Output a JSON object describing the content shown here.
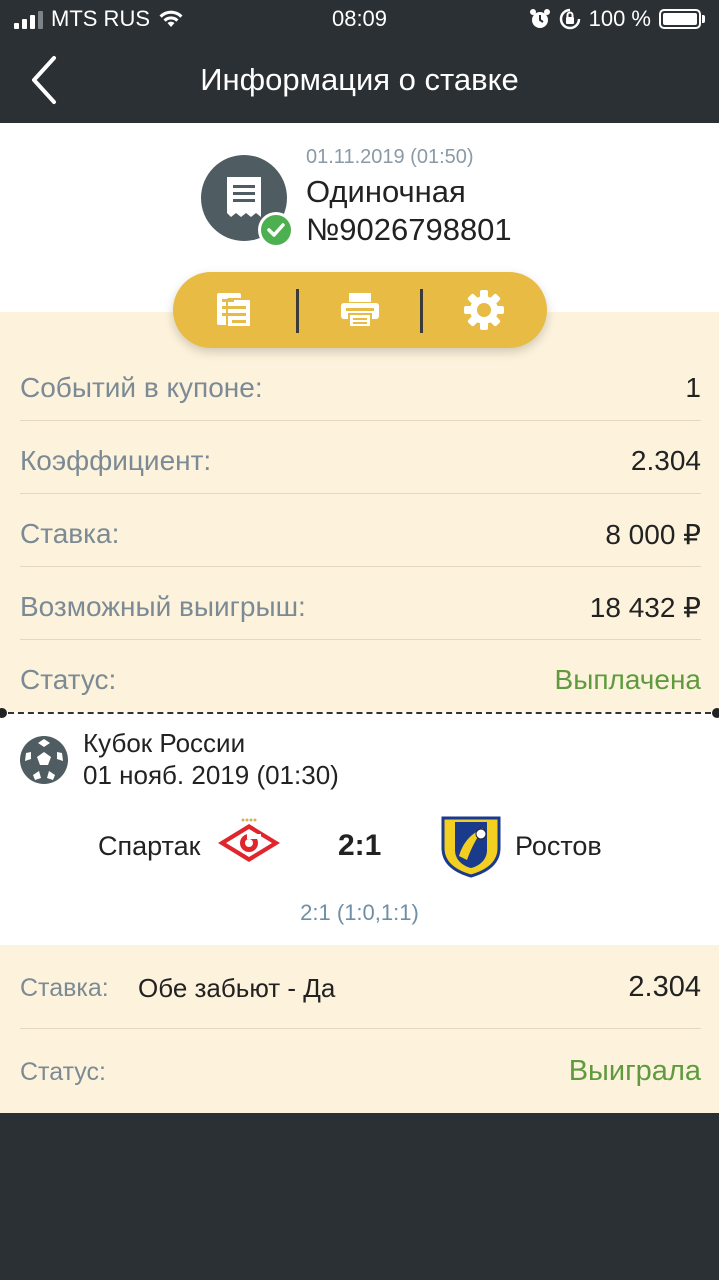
{
  "status_bar": {
    "carrier": "MTS RUS",
    "time": "08:09",
    "battery": "100 %",
    "battery_level": 1.0
  },
  "header": {
    "title": "Информация о ставке",
    "back_icon": "chevron-left-icon"
  },
  "bet": {
    "date": "01.11.2019 (01:50)",
    "type": "Одиночная",
    "number": "№9026798801",
    "icon": "receipt-icon",
    "badge_icon": "check-icon"
  },
  "actions": [
    {
      "icon": "document-list-icon"
    },
    {
      "icon": "printer-icon"
    },
    {
      "icon": "gear-icon"
    }
  ],
  "summary": [
    {
      "label": "Событий в купоне:",
      "value": "1"
    },
    {
      "label": "Коэффициент:",
      "value": "2.304"
    },
    {
      "label": "Ставка:",
      "value": "8 000 ₽"
    },
    {
      "label": "Возможный выигрыш:",
      "value": "18 432 ₽"
    },
    {
      "label": "Статус:",
      "value": "Выплачена"
    }
  ],
  "event": {
    "tournament": "Кубок России",
    "date": "01 нояб. 2019 (01:30)",
    "home_team": "Спартак",
    "away_team": "Ростов",
    "score": "2:1",
    "score_detail": "2:1 (1:0,1:1)",
    "sport_icon": "soccer-ball-icon"
  },
  "details": {
    "bet_label": "Ставка:",
    "bet_value": "Обе забьют - Да",
    "odds": "2.304",
    "status_label": "Статус:",
    "status_value": "Выиграла"
  },
  "colors": {
    "header_bg": "#2b3034",
    "accent": "#e8bb45",
    "beige": "#fdf3dc",
    "green": "#5f9b3e",
    "muted": "#7b8a94"
  }
}
